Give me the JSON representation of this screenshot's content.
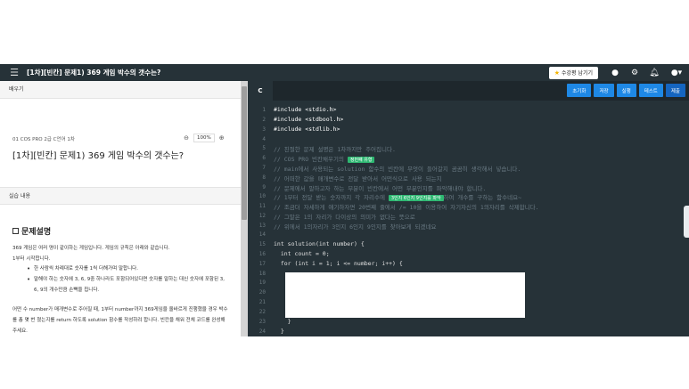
{
  "topbar": {
    "title": "[1차][빈칸] 문제1) 369 게임 박수의 갯수는?",
    "bookmark_label": "수강평 남기기"
  },
  "left": {
    "section1": "배우기",
    "crumb": "01 COS PRO 2급 C언어 1차",
    "zoom": "100%",
    "question_title": "[1차][빈칸] 문제1) 369 게임 박수의 갯수는?",
    "section2": "실습 내용",
    "heading": "문제설명",
    "p1": "369 게임은 여러 명이 같이하는 게임입니다. 게임의 규칙은 아래와 같습니다.",
    "p2": "1부터 시작합니다.",
    "bullets": [
      "한 사람씩 차례대로 숫자를 1씩 더해가며 말합니다.",
      "말해야 하는 숫자에 3, 6, 9중 하나라도 포함되어있다면 숫자를 말하는 대신 숫자에 포함된 3, 6, 9의 개수만큼 손뼉을 칩니다."
    ],
    "p3": "어떤 수 number가 매개변수로 주어질 때, 1부터 number까지 369게임을 올바르게 진행했을 경우 박수를 총 몇 번 쳤는지를 return 하도록 solution 함수를 작성하려 합니다. 빈칸을 채워 전체 코드를 완성해주세요."
  },
  "editor": {
    "tab": "C",
    "buttons": [
      "초기화",
      "저장",
      "실행",
      "테스트",
      "제출"
    ],
    "lines": [
      {
        "n": "1",
        "text": "#include <stdio.h>",
        "cls": "c-dir"
      },
      {
        "n": "2",
        "text": "#include <stdbool.h>",
        "cls": "c-dir"
      },
      {
        "n": "3",
        "text": "#include <stdlib.h>",
        "cls": "c-dir"
      },
      {
        "n": "4",
        "text": "",
        "cls": ""
      },
      {
        "n": "5",
        "text": "// 친절한 문제 설명은 1차까지만 주어집니다.",
        "cls": "c-com"
      },
      {
        "n": "6",
        "text": "// COS PRO 빈칸채우기의",
        "cls": "c-com",
        "badge": "정번째 유형"
      },
      {
        "n": "7",
        "text": "// main에서 사용되는 solution 함수의 빈칸에 무엇이 들어갈지 곰곰히 생각해서 넣습니다.",
        "cls": "c-com"
      },
      {
        "n": "8",
        "text": "// 어떠한 값을 매개변수로 전달 받아서 어떤식으로 사용 되는지",
        "cls": "c-com"
      },
      {
        "n": "9",
        "text": "// 문제에서 말하고자 하는 부분이 빈칸에서 어떤 부분인지를 파악해내야 합니다.",
        "cls": "c-com"
      },
      {
        "n": "10",
        "text": "// 1부터 전달 받는 숫자까지 각 자리수에",
        "cls": "c-com",
        "badge": "3인지 6인지 9인지를 파악",
        "after": "하여 개수를 구하는 함수네요~"
      },
      {
        "n": "11",
        "text": "// 조금더 자세하게 얘기하자면 20번째 줄에서 /= 10을 이용하여 자기자신의 1의자리를 삭제합니다.",
        "cls": "c-com"
      },
      {
        "n": "12",
        "text": "// 그말은 1의 자리가 다이상의 의미가 없다는 뜻으로",
        "cls": "c-com"
      },
      {
        "n": "13",
        "text": "// 위에서 1의자리가 3인지 6인지 9인지를 찾아보게 되겠네요",
        "cls": "c-com"
      },
      {
        "n": "14",
        "text": "",
        "cls": ""
      },
      {
        "n": "15",
        "text": "int solution(int number) {",
        "cls": "c-fn"
      },
      {
        "n": "16",
        "text": "  int count = 0;",
        "cls": "c-fn"
      },
      {
        "n": "17",
        "text": "  for (int i = 1; i <= number; i++) {",
        "cls": "c-fn"
      },
      {
        "n": "18",
        "text": "",
        "cls": ""
      },
      {
        "n": "19",
        "text": "",
        "cls": ""
      },
      {
        "n": "20",
        "text": "",
        "cls": ""
      },
      {
        "n": "21",
        "text": "",
        "cls": ""
      },
      {
        "n": "22",
        "text": "",
        "cls": ""
      },
      {
        "n": "23",
        "text": "    }",
        "cls": "c-fn"
      },
      {
        "n": "24",
        "text": "  }",
        "cls": "c-fn"
      }
    ]
  }
}
